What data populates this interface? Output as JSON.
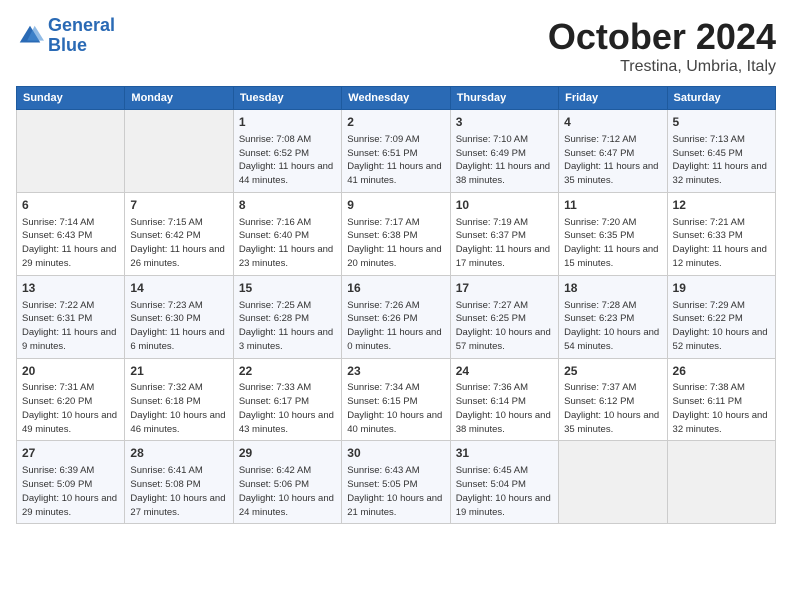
{
  "logo": {
    "line1": "General",
    "line2": "Blue"
  },
  "title": "October 2024",
  "location": "Trestina, Umbria, Italy",
  "days_of_week": [
    "Sunday",
    "Monday",
    "Tuesday",
    "Wednesday",
    "Thursday",
    "Friday",
    "Saturday"
  ],
  "weeks": [
    [
      {
        "day": "",
        "info": ""
      },
      {
        "day": "",
        "info": ""
      },
      {
        "day": "1",
        "info": "Sunrise: 7:08 AM\nSunset: 6:52 PM\nDaylight: 11 hours and 44 minutes."
      },
      {
        "day": "2",
        "info": "Sunrise: 7:09 AM\nSunset: 6:51 PM\nDaylight: 11 hours and 41 minutes."
      },
      {
        "day": "3",
        "info": "Sunrise: 7:10 AM\nSunset: 6:49 PM\nDaylight: 11 hours and 38 minutes."
      },
      {
        "day": "4",
        "info": "Sunrise: 7:12 AM\nSunset: 6:47 PM\nDaylight: 11 hours and 35 minutes."
      },
      {
        "day": "5",
        "info": "Sunrise: 7:13 AM\nSunset: 6:45 PM\nDaylight: 11 hours and 32 minutes."
      }
    ],
    [
      {
        "day": "6",
        "info": "Sunrise: 7:14 AM\nSunset: 6:43 PM\nDaylight: 11 hours and 29 minutes."
      },
      {
        "day": "7",
        "info": "Sunrise: 7:15 AM\nSunset: 6:42 PM\nDaylight: 11 hours and 26 minutes."
      },
      {
        "day": "8",
        "info": "Sunrise: 7:16 AM\nSunset: 6:40 PM\nDaylight: 11 hours and 23 minutes."
      },
      {
        "day": "9",
        "info": "Sunrise: 7:17 AM\nSunset: 6:38 PM\nDaylight: 11 hours and 20 minutes."
      },
      {
        "day": "10",
        "info": "Sunrise: 7:19 AM\nSunset: 6:37 PM\nDaylight: 11 hours and 17 minutes."
      },
      {
        "day": "11",
        "info": "Sunrise: 7:20 AM\nSunset: 6:35 PM\nDaylight: 11 hours and 15 minutes."
      },
      {
        "day": "12",
        "info": "Sunrise: 7:21 AM\nSunset: 6:33 PM\nDaylight: 11 hours and 12 minutes."
      }
    ],
    [
      {
        "day": "13",
        "info": "Sunrise: 7:22 AM\nSunset: 6:31 PM\nDaylight: 11 hours and 9 minutes."
      },
      {
        "day": "14",
        "info": "Sunrise: 7:23 AM\nSunset: 6:30 PM\nDaylight: 11 hours and 6 minutes."
      },
      {
        "day": "15",
        "info": "Sunrise: 7:25 AM\nSunset: 6:28 PM\nDaylight: 11 hours and 3 minutes."
      },
      {
        "day": "16",
        "info": "Sunrise: 7:26 AM\nSunset: 6:26 PM\nDaylight: 11 hours and 0 minutes."
      },
      {
        "day": "17",
        "info": "Sunrise: 7:27 AM\nSunset: 6:25 PM\nDaylight: 10 hours and 57 minutes."
      },
      {
        "day": "18",
        "info": "Sunrise: 7:28 AM\nSunset: 6:23 PM\nDaylight: 10 hours and 54 minutes."
      },
      {
        "day": "19",
        "info": "Sunrise: 7:29 AM\nSunset: 6:22 PM\nDaylight: 10 hours and 52 minutes."
      }
    ],
    [
      {
        "day": "20",
        "info": "Sunrise: 7:31 AM\nSunset: 6:20 PM\nDaylight: 10 hours and 49 minutes."
      },
      {
        "day": "21",
        "info": "Sunrise: 7:32 AM\nSunset: 6:18 PM\nDaylight: 10 hours and 46 minutes."
      },
      {
        "day": "22",
        "info": "Sunrise: 7:33 AM\nSunset: 6:17 PM\nDaylight: 10 hours and 43 minutes."
      },
      {
        "day": "23",
        "info": "Sunrise: 7:34 AM\nSunset: 6:15 PM\nDaylight: 10 hours and 40 minutes."
      },
      {
        "day": "24",
        "info": "Sunrise: 7:36 AM\nSunset: 6:14 PM\nDaylight: 10 hours and 38 minutes."
      },
      {
        "day": "25",
        "info": "Sunrise: 7:37 AM\nSunset: 6:12 PM\nDaylight: 10 hours and 35 minutes."
      },
      {
        "day": "26",
        "info": "Sunrise: 7:38 AM\nSunset: 6:11 PM\nDaylight: 10 hours and 32 minutes."
      }
    ],
    [
      {
        "day": "27",
        "info": "Sunrise: 6:39 AM\nSunset: 5:09 PM\nDaylight: 10 hours and 29 minutes."
      },
      {
        "day": "28",
        "info": "Sunrise: 6:41 AM\nSunset: 5:08 PM\nDaylight: 10 hours and 27 minutes."
      },
      {
        "day": "29",
        "info": "Sunrise: 6:42 AM\nSunset: 5:06 PM\nDaylight: 10 hours and 24 minutes."
      },
      {
        "day": "30",
        "info": "Sunrise: 6:43 AM\nSunset: 5:05 PM\nDaylight: 10 hours and 21 minutes."
      },
      {
        "day": "31",
        "info": "Sunrise: 6:45 AM\nSunset: 5:04 PM\nDaylight: 10 hours and 19 minutes."
      },
      {
        "day": "",
        "info": ""
      },
      {
        "day": "",
        "info": ""
      }
    ]
  ]
}
